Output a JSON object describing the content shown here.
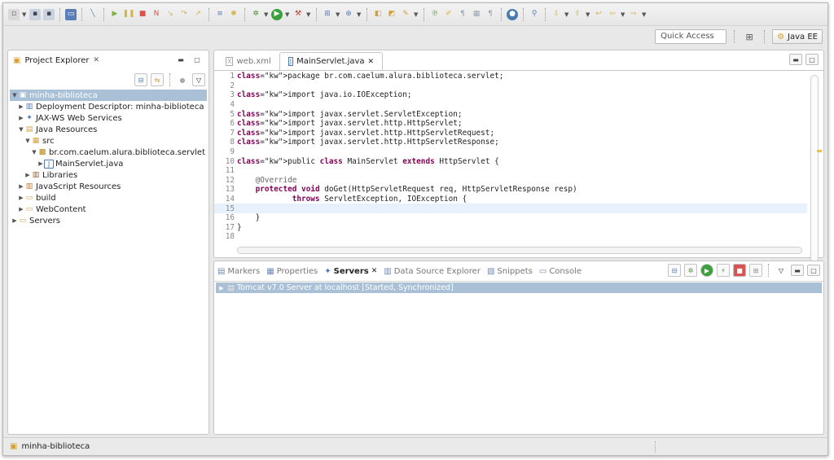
{
  "toolbar": {
    "quick_access": "Quick Access",
    "perspective_label": "Java EE"
  },
  "explorer": {
    "title": "Project Explorer",
    "tree": [
      {
        "label": "minha-biblioteca",
        "level": 0,
        "expanded": true,
        "icon": "project-icon",
        "selected": true
      },
      {
        "label": "Deployment Descriptor: minha-biblioteca",
        "level": 1,
        "expanded": false,
        "icon": "deployment-descriptor-icon"
      },
      {
        "label": "JAX-WS Web Services",
        "level": 1,
        "expanded": false,
        "icon": "web-services-icon"
      },
      {
        "label": "Java Resources",
        "level": 1,
        "expanded": true,
        "icon": "java-resources-icon"
      },
      {
        "label": "src",
        "level": 2,
        "expanded": true,
        "icon": "source-folder-icon"
      },
      {
        "label": "br.com.caelum.alura.biblioteca.servlet",
        "level": 3,
        "expanded": true,
        "icon": "package-icon"
      },
      {
        "label": "MainServlet.java",
        "level": 4,
        "expanded": false,
        "icon": "java-file-icon"
      },
      {
        "label": "Libraries",
        "level": 2,
        "expanded": false,
        "icon": "libraries-icon"
      },
      {
        "label": "JavaScript Resources",
        "level": 1,
        "expanded": false,
        "icon": "javascript-resources-icon"
      },
      {
        "label": "build",
        "level": 1,
        "expanded": false,
        "icon": "folder-icon"
      },
      {
        "label": "WebContent",
        "level": 1,
        "expanded": false,
        "icon": "folder-icon"
      },
      {
        "label": "Servers",
        "level": 0,
        "expanded": false,
        "icon": "folder-icon"
      }
    ]
  },
  "editor": {
    "tabs": [
      {
        "label": "web.xml",
        "active": false
      },
      {
        "label": "MainServlet.java",
        "active": true
      }
    ],
    "lines": [
      {
        "n": "1",
        "text": "package br.com.caelum.alura.biblioteca.servlet;"
      },
      {
        "n": "2",
        "text": ""
      },
      {
        "n": "3",
        "text": "import java.io.IOException;"
      },
      {
        "n": "4",
        "text": ""
      },
      {
        "n": "5",
        "text": "import javax.servlet.ServletException;"
      },
      {
        "n": "6",
        "text": "import javax.servlet.http.HttpServlet;"
      },
      {
        "n": "7",
        "text": "import javax.servlet.http.HttpServletRequest;"
      },
      {
        "n": "8",
        "text": "import javax.servlet.http.HttpServletResponse;"
      },
      {
        "n": "9",
        "text": ""
      },
      {
        "n": "10",
        "text": "public class MainServlet extends HttpServlet {"
      },
      {
        "n": "11",
        "text": ""
      },
      {
        "n": "12",
        "text": "    @Override"
      },
      {
        "n": "13",
        "text": "    protected void doGet(HttpServletRequest req, HttpServletResponse resp)"
      },
      {
        "n": "14",
        "text": "            throws ServletException, IOException {"
      },
      {
        "n": "15",
        "text": ""
      },
      {
        "n": "16",
        "text": "    }"
      },
      {
        "n": "17",
        "text": "}"
      },
      {
        "n": "18",
        "text": ""
      }
    ]
  },
  "bottom": {
    "tabs": [
      {
        "label": "Markers",
        "active": false,
        "icon": "markers-icon"
      },
      {
        "label": "Properties",
        "active": false,
        "icon": "properties-icon"
      },
      {
        "label": "Servers",
        "active": true,
        "icon": "servers-icon"
      },
      {
        "label": "Data Source Explorer",
        "active": false,
        "icon": "data-source-icon"
      },
      {
        "label": "Snippets",
        "active": false,
        "icon": "snippets-icon"
      },
      {
        "label": "Console",
        "active": false,
        "icon": "console-icon"
      }
    ],
    "server_row": "Tomcat v7.0 Server at localhost  [Started, Synchronized]"
  },
  "status": {
    "project": "minha-biblioteca"
  },
  "colors": {
    "selection": "#a9c0d6",
    "keyword": "#7f0055"
  }
}
